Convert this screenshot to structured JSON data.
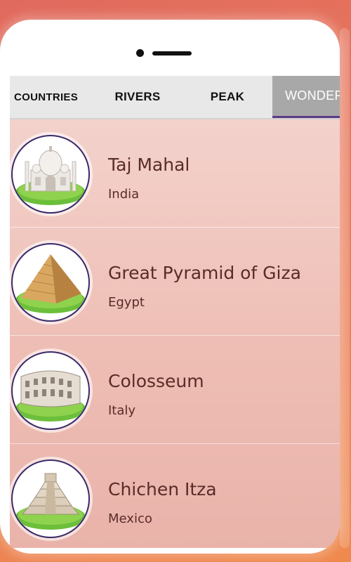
{
  "tabs": [
    {
      "label": "COUNTRIES"
    },
    {
      "label": "RIVERS"
    },
    {
      "label": "PEAK"
    },
    {
      "label": "WONDERS",
      "selected": true
    }
  ],
  "wonders": [
    {
      "name": "Taj Mahal",
      "country": "India",
      "icon": "taj-mahal-icon"
    },
    {
      "name": "Great Pyramid of Giza",
      "country": "Egypt",
      "icon": "pyramid-icon"
    },
    {
      "name": "Colosseum",
      "country": "Italy",
      "icon": "colosseum-icon"
    },
    {
      "name": "Chichen Itza",
      "country": "Mexico",
      "icon": "chichen-itza-icon"
    }
  ],
  "colors": {
    "selected_tab_bg": "#a8a8a8",
    "selected_tab_underline": "#5b3b86",
    "text": "#5a2c28"
  }
}
